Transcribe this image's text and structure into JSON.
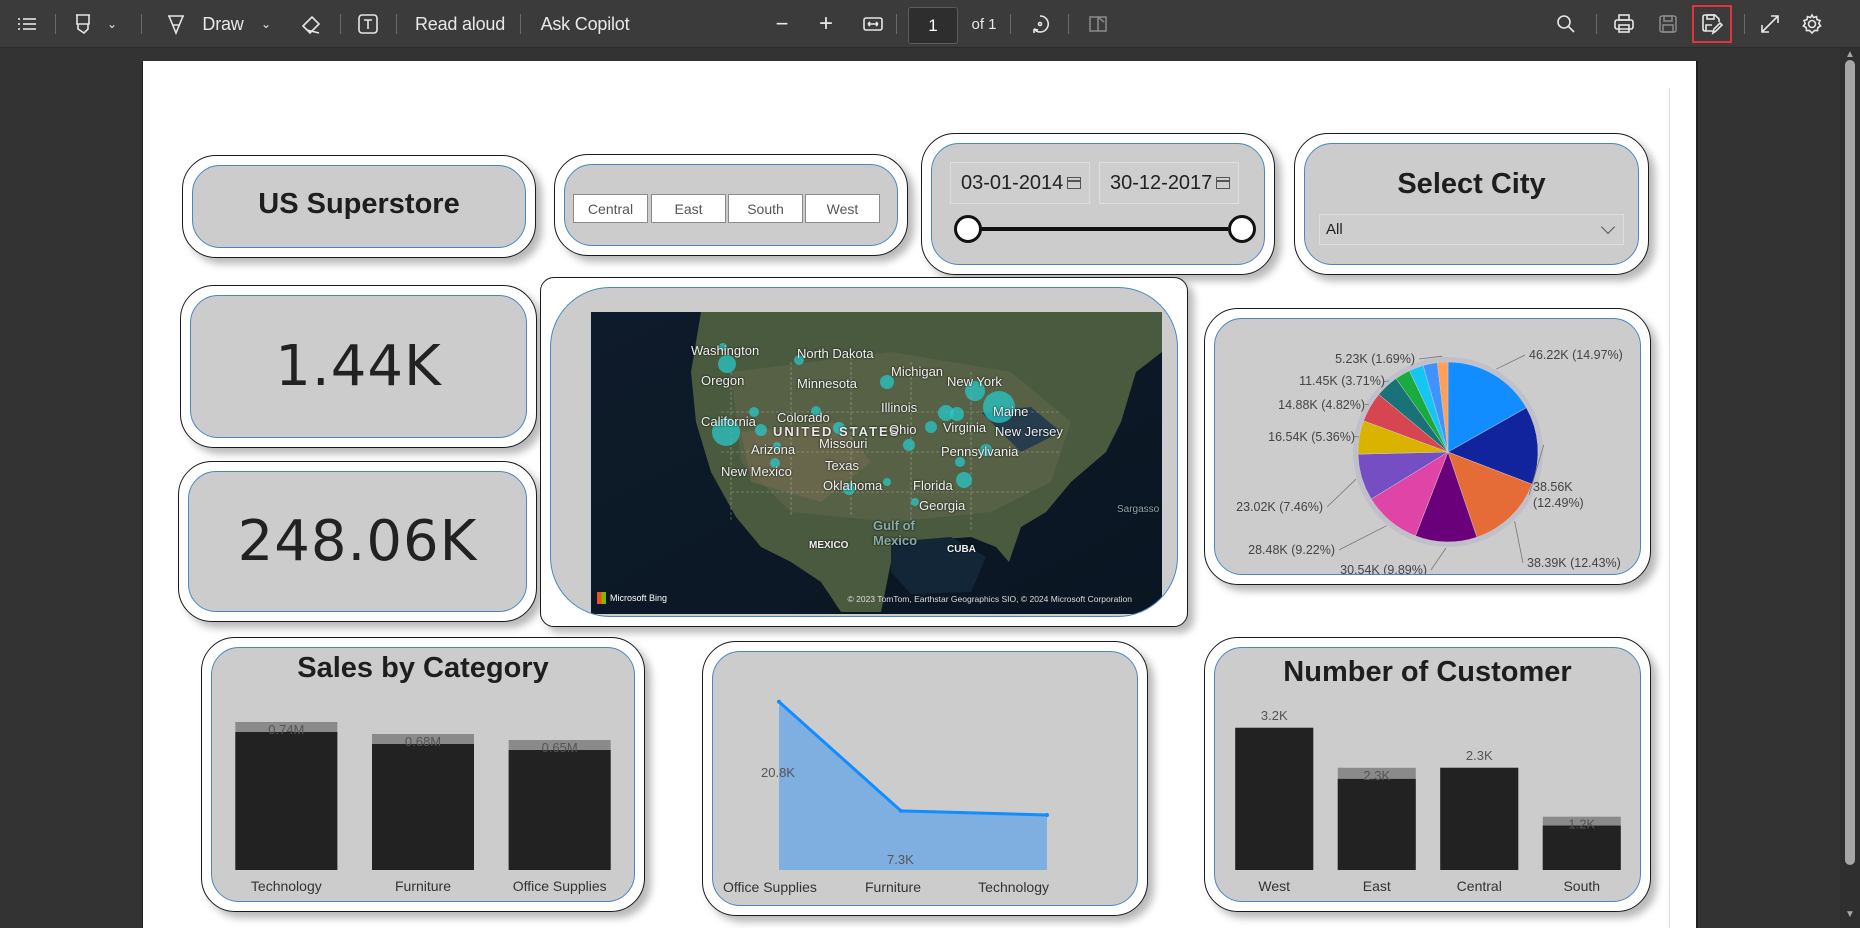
{
  "toolbar": {
    "items": [
      {
        "name": "contents-icon",
        "label": ""
      },
      {
        "name": "highlight-icon",
        "label": ""
      },
      {
        "name": "draw",
        "label": "Draw"
      },
      {
        "name": "erase-icon",
        "label": ""
      },
      {
        "name": "text-icon",
        "label": ""
      },
      {
        "name": "read-aloud",
        "label": "Read aloud"
      },
      {
        "name": "ask-copilot",
        "label": "Ask Copilot"
      }
    ],
    "read_aloud": "Read aloud",
    "ask_copilot": "Ask Copilot",
    "draw": "Draw",
    "zoom_out": "−",
    "zoom_in": "+",
    "page_current": "1",
    "page_total": "of 1",
    "highlighted_button": "save-as-icon"
  },
  "dashboard": {
    "title": "US Superstore",
    "regions": [
      "Central",
      "East",
      "South",
      "West"
    ],
    "date_range": {
      "start": "03-01-2014",
      "end": "30-12-2017",
      "start_fraction": 0,
      "end_fraction": 1
    },
    "city_filter": {
      "title": "Select City",
      "selected": "All"
    },
    "kpis": [
      {
        "value": "1.44K"
      },
      {
        "value": "248.06K"
      }
    ],
    "map": {
      "labels": [
        "Washington",
        "North Dakota",
        "Oregon",
        "Minnesota",
        "Michigan",
        "New York",
        "Illinois",
        "Maine",
        "California",
        "Colorado",
        "UNITED STATES",
        "Ohio",
        "Virginia",
        "New Jersey",
        "Missouri",
        "Arizona",
        "Pennsylvania",
        "Texas",
        "New Mexico",
        "Oklahoma",
        "Florida",
        "Georgia",
        "Gulf of Mexico",
        "MEXICO",
        "CUBA",
        "Sargasso"
      ],
      "attribution": "© 2023 TomTom, Earthstar Geographics SIO, © 2024 Microsoft Corporation",
      "provider": "Microsoft Bing"
    }
  },
  "chart_data": [
    {
      "type": "pie",
      "title": "",
      "slices": [
        {
          "label": "46.22K (14.97%)",
          "value": 46.22,
          "percent": 14.97,
          "color": "#118dff"
        },
        {
          "label": "38.56K (12.49%)",
          "value": 38.56,
          "percent": 12.49,
          "color": "#12239e"
        },
        {
          "label": "38.39K (12.43%)",
          "value": 38.39,
          "percent": 12.43,
          "color": "#e66c37"
        },
        {
          "label": "30.54K (9.89%)",
          "value": 30.54,
          "percent": 9.89,
          "color": "#6b007b"
        },
        {
          "label": "28.48K (9.22%)",
          "value": 28.48,
          "percent": 9.22,
          "color": "#e044a7"
        },
        {
          "label": "23.02K (7.46%)",
          "value": 23.02,
          "percent": 7.46,
          "color": "#744ec2"
        },
        {
          "label": "16.54K (5.36%)",
          "value": 16.54,
          "percent": 5.36,
          "color": "#d9b300"
        },
        {
          "label": "14.88K (4.82%)",
          "value": 14.88,
          "percent": 4.82,
          "color": "#d64550"
        },
        {
          "label": "11.45K (3.71%)",
          "value": 11.45,
          "percent": 3.71,
          "color": "#197278"
        },
        {
          "label": "",
          "value": 7.5,
          "percent": 2.43,
          "color": "#1aab40"
        },
        {
          "label": "",
          "value": 7.2,
          "percent": 2.33,
          "color": "#15c6f4"
        },
        {
          "label": "",
          "value": 7.0,
          "percent": 2.27,
          "color": "#4092ff"
        },
        {
          "label": "5.23K (1.69%)",
          "value": 5.23,
          "percent": 1.69,
          "color": "#ffa058"
        }
      ]
    },
    {
      "type": "bar",
      "title": "Sales by Category",
      "categories": [
        "Technology",
        "Furniture",
        "Office Supplies"
      ],
      "values": [
        0.74,
        0.68,
        0.65
      ],
      "data_labels": [
        "0.74M",
        "0.68M",
        "0.65M"
      ],
      "dark_values": [
        0.69,
        0.63,
        0.6
      ],
      "unit": "M",
      "ylim": [
        0,
        0.8
      ]
    },
    {
      "type": "area",
      "title": "",
      "categories": [
        "Office Supplies",
        "Furniture",
        "Technology"
      ],
      "values": [
        20.8,
        7.3,
        6.8
      ],
      "data_labels": [
        "20.8K",
        "7.3K",
        ""
      ],
      "unit": "K",
      "ylim": [
        0,
        22
      ]
    },
    {
      "type": "bar",
      "title": "Number of Customer",
      "categories": [
        "West",
        "East",
        "Central",
        "South"
      ],
      "values": [
        3.2,
        2.3,
        2.3,
        1.2
      ],
      "data_labels": [
        "3.2K",
        "2.3K",
        "2.3K",
        "1.2K"
      ],
      "dark_values": [
        3.2,
        2.05,
        2.3,
        1.0
      ],
      "unit": "K",
      "ylim": [
        0,
        3.6
      ]
    }
  ]
}
